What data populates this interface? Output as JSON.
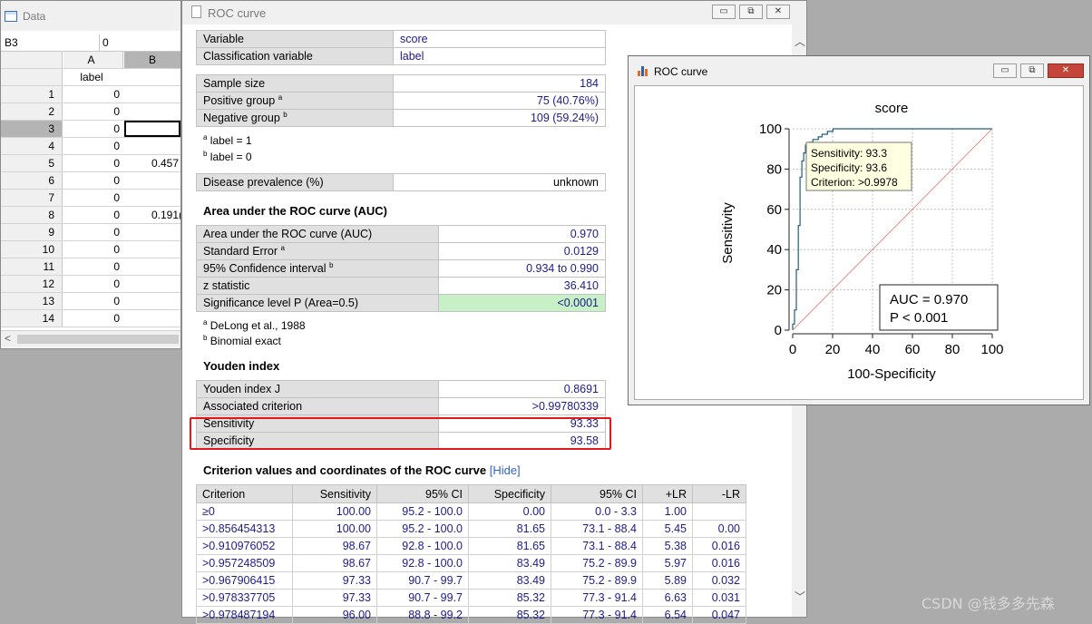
{
  "data_window": {
    "title": "Data",
    "cell_ref": "B3",
    "cell_value": "0",
    "col_a": "A",
    "col_b": "B",
    "col_a_label": "label",
    "rows": [
      {
        "n": "1",
        "a": "0",
        "b": ""
      },
      {
        "n": "2",
        "a": "0",
        "b": ""
      },
      {
        "n": "3",
        "a": "0",
        "b": ""
      },
      {
        "n": "4",
        "a": "0",
        "b": ""
      },
      {
        "n": "5",
        "a": "0",
        "b": "0.457"
      },
      {
        "n": "6",
        "a": "0",
        "b": ""
      },
      {
        "n": "7",
        "a": "0",
        "b": ""
      },
      {
        "n": "8",
        "a": "0",
        "b": "0.191("
      },
      {
        "n": "9",
        "a": "0",
        "b": ""
      },
      {
        "n": "10",
        "a": "0",
        "b": ""
      },
      {
        "n": "11",
        "a": "0",
        "b": ""
      },
      {
        "n": "12",
        "a": "0",
        "b": ""
      },
      {
        "n": "13",
        "a": "0",
        "b": ""
      },
      {
        "n": "14",
        "a": "0",
        "b": ""
      }
    ]
  },
  "report": {
    "title": "ROC curve",
    "variable_label": "Variable",
    "variable_value": "score",
    "class_label": "Classification variable",
    "class_value": "label",
    "sample_size_label": "Sample size",
    "sample_size": "184",
    "positive_label": "Positive group",
    "positive_sup": "a",
    "positive_value": "75 (40.76%)",
    "negative_label": "Negative group",
    "negative_sup": "b",
    "negative_value": "109 (59.24%)",
    "note_a_sup": "a",
    "note_a": "label = 1",
    "note_b_sup": "b",
    "note_b": "label = 0",
    "prevalence_label": "Disease prevalence (%)",
    "prevalence_value": "unknown",
    "auc_heading": "Area under the ROC curve (AUC)",
    "auc_label": "Area under the ROC curve (AUC)",
    "auc_value": "0.970",
    "se_label": "Standard Error",
    "se_sup": "a",
    "se_value": "0.0129",
    "ci_label": "95% Confidence interval",
    "ci_sup": "b",
    "ci_value": "0.934 to 0.990",
    "z_label": "z statistic",
    "z_value": "36.410",
    "p_label": "Significance level P (Area=0.5)",
    "p_value": "<0.0001",
    "foot_a_sup": "a",
    "foot_a": "DeLong et al., 1988",
    "foot_b_sup": "b",
    "foot_b": "Binomial exact",
    "youden_heading": "Youden index",
    "youden_label": "Youden index J",
    "youden_value": "0.8691",
    "crit_label": "Associated criterion",
    "crit_value": ">0.99780339",
    "sens_label": "Sensitivity",
    "sens_value": "93.33",
    "spec_label": "Specificity",
    "spec_value": "93.58",
    "crit_heading": "Criterion values and coordinates of the ROC curve",
    "hide_link": "[Hide]",
    "crit_columns": [
      "Criterion",
      "Sensitivity",
      "95% CI",
      "Specificity",
      "95% CI",
      "+LR",
      "-LR"
    ],
    "crit_rows": [
      [
        "≥0",
        "100.00",
        "95.2 - 100.0",
        "0.00",
        "0.0 - 3.3",
        "1.00",
        ""
      ],
      [
        ">0.856454313",
        "100.00",
        "95.2 - 100.0",
        "81.65",
        "73.1 - 88.4",
        "5.45",
        "0.00"
      ],
      [
        ">0.910976052",
        "98.67",
        "92.8 - 100.0",
        "81.65",
        "73.1 - 88.4",
        "5.38",
        "0.016"
      ],
      [
        ">0.957248509",
        "98.67",
        "92.8 - 100.0",
        "83.49",
        "75.2 - 89.9",
        "5.97",
        "0.016"
      ],
      [
        ">0.967906415",
        "97.33",
        "90.7 - 99.7",
        "83.49",
        "75.2 - 89.9",
        "5.89",
        "0.032"
      ],
      [
        ">0.978337705",
        "97.33",
        "90.7 - 99.7",
        "85.32",
        "77.3 - 91.4",
        "6.63",
        "0.031"
      ],
      [
        ">0.978487194",
        "96.00",
        "88.8 - 99.2",
        "85.32",
        "77.3 - 91.4",
        "6.54",
        "0.047"
      ]
    ]
  },
  "plot_window": {
    "title": "ROC curve",
    "tooltip": [
      "Sensitivity: 93.3",
      "Specificity: 93.6",
      "Criterion: >0.9978"
    ],
    "auc_box": [
      "AUC = 0.970",
      "P < 0.001"
    ]
  },
  "chart_data": {
    "type": "line",
    "title": "score",
    "xlabel": "100-Specificity",
    "ylabel": "Sensitivity",
    "xlim": [
      0,
      100
    ],
    "ylim": [
      0,
      100
    ],
    "xticks": [
      "0",
      "20",
      "40",
      "60",
      "80",
      "100"
    ],
    "yticks": [
      "0",
      "20",
      "40",
      "60",
      "80",
      "100"
    ],
    "grid": true,
    "series": [
      {
        "color": "#1f5f7a",
        "x": [
          0,
          0,
          0.9,
          0.9,
          1.8,
          1.8,
          2.8,
          2.8,
          3.7,
          3.7,
          4.6,
          4.6,
          5.5,
          5.5,
          6.4,
          6.4,
          8.3,
          8.3,
          10.1,
          10.1,
          12.8,
          12.8,
          14.7,
          14.7,
          17.4,
          17.4,
          20.2,
          20.2,
          100
        ],
        "y": [
          0,
          3,
          3,
          10,
          10,
          30,
          30,
          52,
          52,
          76,
          76,
          84,
          84,
          88,
          88,
          92,
          92,
          93.3,
          93.3,
          94.7,
          94.7,
          96,
          96,
          97.3,
          97.3,
          98.7,
          98.7,
          100,
          100
        ]
      },
      {
        "color": "#e07070",
        "x": [
          0,
          100
        ],
        "y": [
          0,
          100
        ]
      }
    ]
  },
  "watermark": "CSDN @钱多多先森"
}
